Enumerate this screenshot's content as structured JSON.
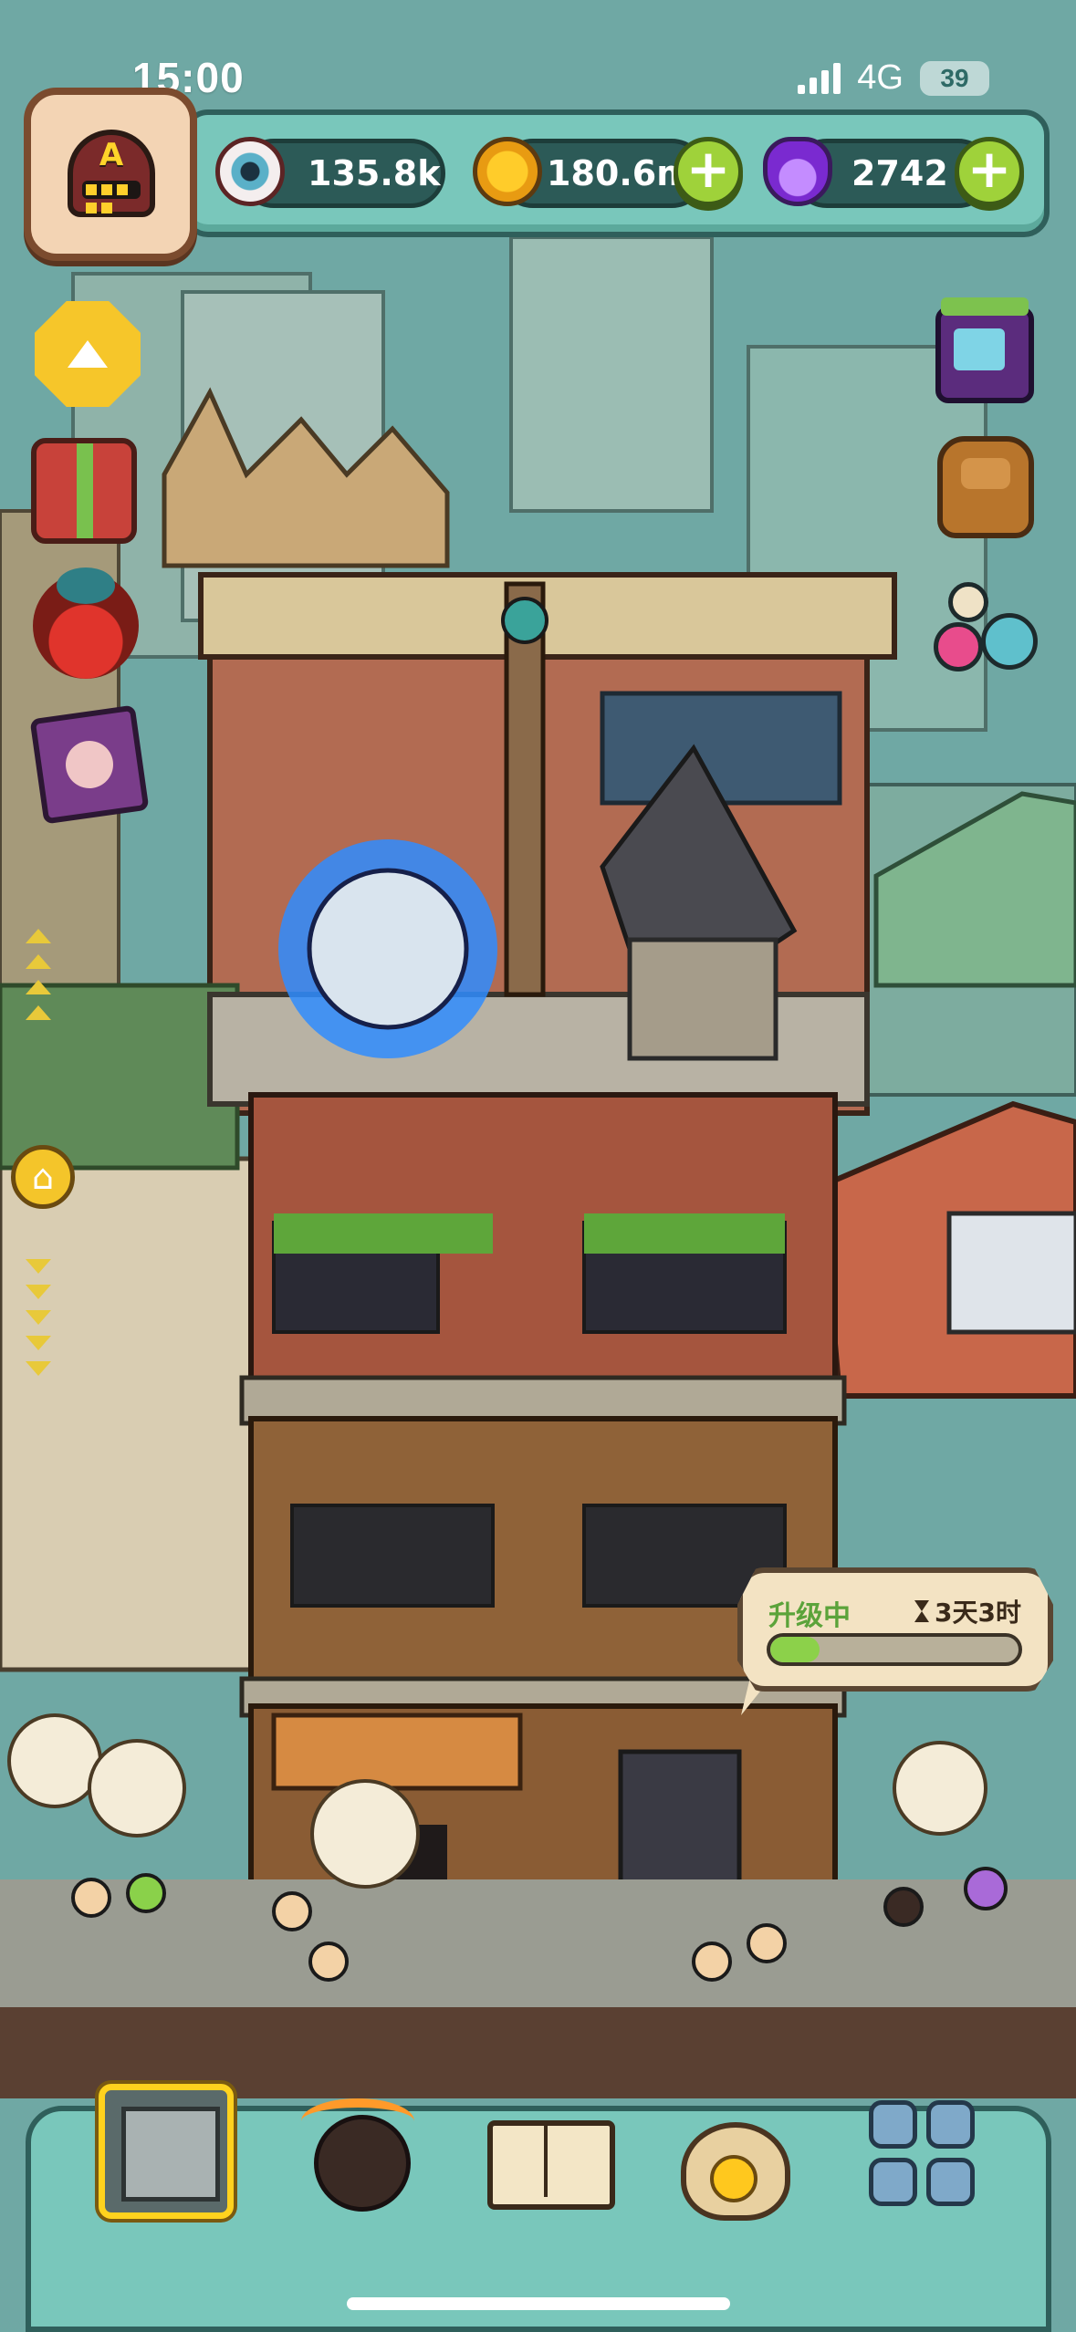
{
  "status_bar": {
    "time": "15:00",
    "network": "4G",
    "battery": "39"
  },
  "player": {
    "avatar_badge_letter": "A"
  },
  "resources": [
    {
      "name": "eyeballs",
      "icon": "eyeball-icon",
      "value": "135.8k",
      "has_plus": false
    },
    {
      "name": "coins",
      "icon": "coin-icon",
      "value": "180.6m",
      "has_plus": true
    },
    {
      "name": "potions",
      "icon": "potion-icon",
      "value": "2742",
      "has_plus": true
    }
  ],
  "left_menu": [
    {
      "name": "collapse-button",
      "icon": "up-arrow-icon"
    },
    {
      "name": "gift-box-button",
      "icon": "gift-box-icon"
    },
    {
      "name": "fruit-button",
      "icon": "fruit-icon"
    },
    {
      "name": "cards-button",
      "icon": "cards-icon"
    },
    {
      "name": "home-button",
      "icon": "home-icon"
    }
  ],
  "right_menu": [
    {
      "name": "tv-shop-button",
      "icon": "tv-icon"
    },
    {
      "name": "backpack-button",
      "icon": "backpack-icon"
    },
    {
      "name": "monsters-button",
      "icon": "monster-eggs-icon"
    }
  ],
  "upgrade": {
    "label": "升级中",
    "timer": "3天3时",
    "progress_percent": 20,
    "icon": "hourglass-icon"
  },
  "bottom_nav": [
    {
      "name": "buildings",
      "icon": "building-icon",
      "active": true
    },
    {
      "name": "monsters",
      "icon": "monster-icon",
      "active": false
    },
    {
      "name": "book",
      "icon": "book-icon",
      "active": false
    },
    {
      "name": "bag",
      "icon": "coin-bag-icon",
      "active": false
    },
    {
      "name": "menu",
      "icon": "grid-icon",
      "active": false
    }
  ],
  "colors": {
    "hud_teal": "#79c7bb",
    "hud_border": "#2f5f5b",
    "plus_green": "#9fd23a",
    "progress_green": "#8cd14a",
    "active_nav_yellow": "#ffd21e"
  }
}
